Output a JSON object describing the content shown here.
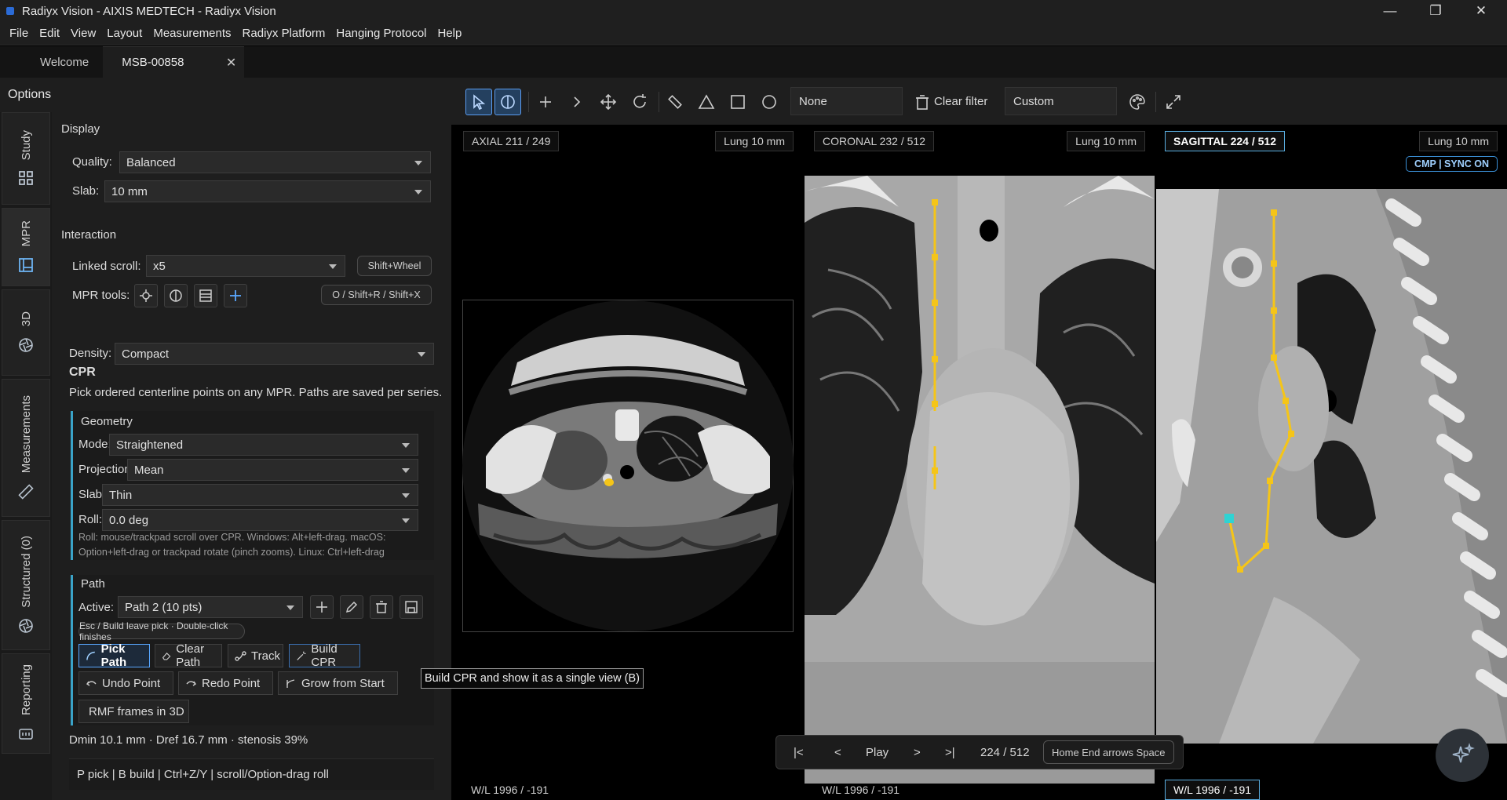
{
  "window": {
    "title": "Radiyx Vision - AIXIS MEDTECH - Radiyx Vision"
  },
  "menu": [
    "File",
    "Edit",
    "View",
    "Layout",
    "Measurements",
    "Radiyx Platform",
    "Hanging Protocol",
    "Help"
  ],
  "tabs": {
    "welcome": "Welcome",
    "study": "MSB-00858"
  },
  "options_title": "Options",
  "rail": [
    {
      "label": "Study",
      "icon": "grid-icon"
    },
    {
      "label": "MPR",
      "icon": "layout-icon"
    },
    {
      "label": "3D",
      "icon": "aperture-icon"
    },
    {
      "label": "Measurements",
      "icon": "ruler-icon"
    },
    {
      "label": "Structured (0)",
      "icon": "aperture-icon"
    },
    {
      "label": "Reporting",
      "icon": "report-icon"
    }
  ],
  "display": {
    "title": "Display",
    "quality_label": "Quality:",
    "quality_value": "Balanced",
    "slab_label": "Slab:",
    "slab_value": "10 mm"
  },
  "interaction": {
    "title": "Interaction",
    "linked_label": "Linked scroll:",
    "linked_value": "x5",
    "linked_hint": "Shift+Wheel",
    "tools_label": "MPR tools:",
    "tools_hint": "O / Shift+R / Shift+X"
  },
  "density": {
    "label": "Density:",
    "value": "Compact"
  },
  "cpr": {
    "title": "CPR",
    "desc": "Pick ordered centerline points on any MPR. Paths are saved per series.",
    "geometry": {
      "title": "Geometry",
      "mode_label": "Mode:",
      "mode_value": "Straightened",
      "proj_label": "Projection:",
      "proj_value": "Mean",
      "slab_label": "Slab:",
      "slab_value": "Thin",
      "roll_label": "Roll:",
      "roll_value": "0.0 deg",
      "note1": "Roll: mouse/trackpad scroll over CPR. Windows: Alt+left-drag. macOS:",
      "note2": "Option+left-drag or trackpad rotate (pinch zooms). Linux: Ctrl+left-drag"
    },
    "path": {
      "title": "Path",
      "active_label": "Active:",
      "active_value": "Path 2 (10 pts)",
      "hint": "Esc / Build leave pick · Double-click finishes",
      "pick": "Pick Path",
      "clear": "Clear Path",
      "track": "Track",
      "build": "Build CPR",
      "undo": "Undo Point",
      "redo": "Redo Point",
      "grow": "Grow from Start",
      "rmf": "RMF frames in 3D"
    },
    "stats": "Dmin 10.1 mm  ·  Dref 16.7 mm  ·  stenosis 39%",
    "shortcuts": "P pick | B build | Ctrl+Z/Y | scroll/Option-drag roll"
  },
  "toolbar": {
    "filter_value": "None",
    "clear_filter": "Clear filter",
    "preset_value": "Custom"
  },
  "views": {
    "axial": {
      "label": "AXIAL  211 / 249",
      "window": "Lung  10 mm",
      "wl": "W/L 1996 / -191"
    },
    "coronal": {
      "label": "CORONAL  232 / 512",
      "window": "Lung  10 mm",
      "wl": "W/L 1996 / -191"
    },
    "sagittal": {
      "label": "SAGITTAL  224 / 512",
      "window": "Lung  10 mm",
      "sync": "CMP | SYNC ON",
      "wl": "W/L 1996 / -191"
    }
  },
  "player": {
    "first": "|<",
    "prev": "<",
    "play": "Play",
    "next": ">",
    "last": ">|",
    "counter": "224 / 512",
    "keys": "Home End  arrows  Space"
  },
  "tooltip": "Build CPR and show it as a single view (B)",
  "colors": {
    "accent": "#3aa3c8",
    "path": "#f5c518",
    "active": "#58a7ff",
    "marker": "#2fd3d3"
  }
}
